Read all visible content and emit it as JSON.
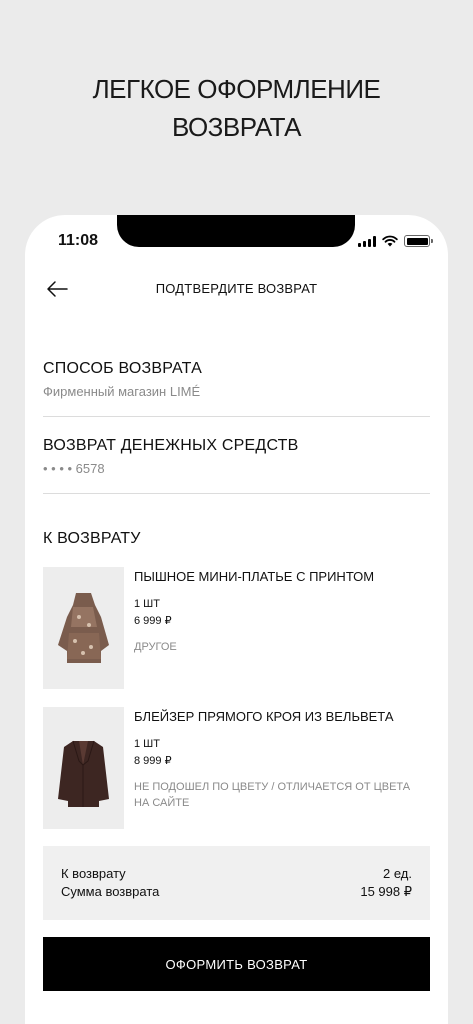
{
  "headline": {
    "line1": "ЛЕГКОЕ ОФОРМЛЕНИЕ",
    "line2": "ВОЗВРАТА"
  },
  "status_bar": {
    "time": "11:08"
  },
  "nav": {
    "title": "ПОДТВЕРДИТЕ ВОЗВРАТ",
    "back_icon": "arrow-left-icon"
  },
  "return_method": {
    "title": "СПОСОБ ВОЗВРАТА",
    "value": "Фирменный магазин LIMÉ"
  },
  "refund": {
    "title": "ВОЗВРАТ ДЕНЕЖНЫХ СРЕДСТВ",
    "card": "• • • •  6578"
  },
  "to_return": {
    "title": "К ВОЗВРАТУ",
    "items": [
      {
        "name": "ПЫШНОЕ МИНИ-ПЛАТЬЕ С ПРИНТОМ",
        "qty": "1 ШТ",
        "price": "6 999 ₽",
        "reason": "ДРУГОЕ"
      },
      {
        "name": "БЛЕЙЗЕР ПРЯМОГО КРОЯ ИЗ ВЕЛЬВЕТА",
        "qty": "1 ШТ",
        "price": "8 999 ₽",
        "reason_line1": "НЕ ПОДОШЕЛ ПО ЦВЕТУ / ОТЛИЧАЕТСЯ ОТ ЦВЕТА",
        "reason_line2": "НА САЙТЕ"
      }
    ]
  },
  "summary": {
    "count_label": "К возврату",
    "count_value": "2 ед.",
    "sum_label": "Сумма возврата",
    "sum_value": "15 998 ₽"
  },
  "submit_label": "ОФОРМИТЬ ВОЗВРАТ"
}
